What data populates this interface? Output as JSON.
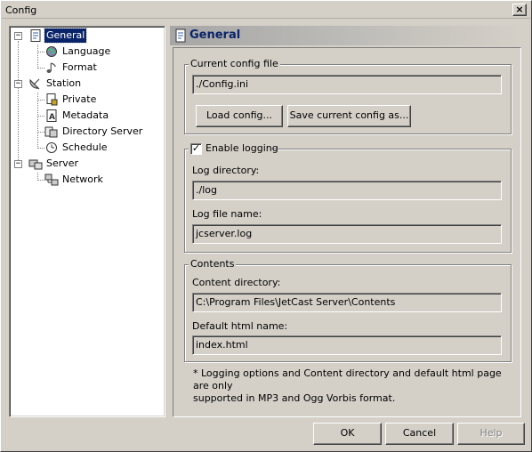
{
  "window": {
    "title": "Config",
    "close_glyph": "×"
  },
  "tree": {
    "items": [
      {
        "label": "General",
        "icon": "document-icon",
        "selected": true
      },
      {
        "label": "Language",
        "icon": "globe-icon"
      },
      {
        "label": "Format",
        "icon": "music-note-icon"
      },
      {
        "label": "Station",
        "icon": "satellite-dish-icon"
      },
      {
        "label": "Private",
        "icon": "lock-document-icon"
      },
      {
        "label": "Metadata",
        "icon": "text-document-icon"
      },
      {
        "label": "Directory Server",
        "icon": "directory-icon"
      },
      {
        "label": "Schedule",
        "icon": "clock-icon"
      },
      {
        "label": "Server",
        "icon": "server-icon"
      },
      {
        "label": "Network",
        "icon": "network-icon"
      }
    ],
    "collapse_glyph": "−"
  },
  "panel": {
    "title": "General",
    "config_file": {
      "legend": "Current config file",
      "value": "./Config.ini",
      "load_button": "Load config...",
      "save_button": "Save current config as..."
    },
    "logging": {
      "checkbox_label": "Enable logging",
      "checked": true,
      "check_glyph": "✓",
      "log_dir_label": "Log directory:",
      "log_dir_value": "./log",
      "log_file_label": "Log file name:",
      "log_file_value": "jcserver.log"
    },
    "contents": {
      "legend": "Contents",
      "dir_label": "Content directory:",
      "dir_value": "C:\\Program Files\\JetCast Server\\Contents",
      "html_label": "Default html name:",
      "html_value": "index.html"
    },
    "note_line1": "* Logging options and Content directory and default html page are only",
    "note_line2": "supported in MP3 and Ogg Vorbis format."
  },
  "footer": {
    "ok": "OK",
    "cancel": "Cancel",
    "help": "Help"
  },
  "colors": {
    "selection": "#0a246a",
    "face": "#d4d0c8",
    "title_blue": "#0a246a"
  }
}
